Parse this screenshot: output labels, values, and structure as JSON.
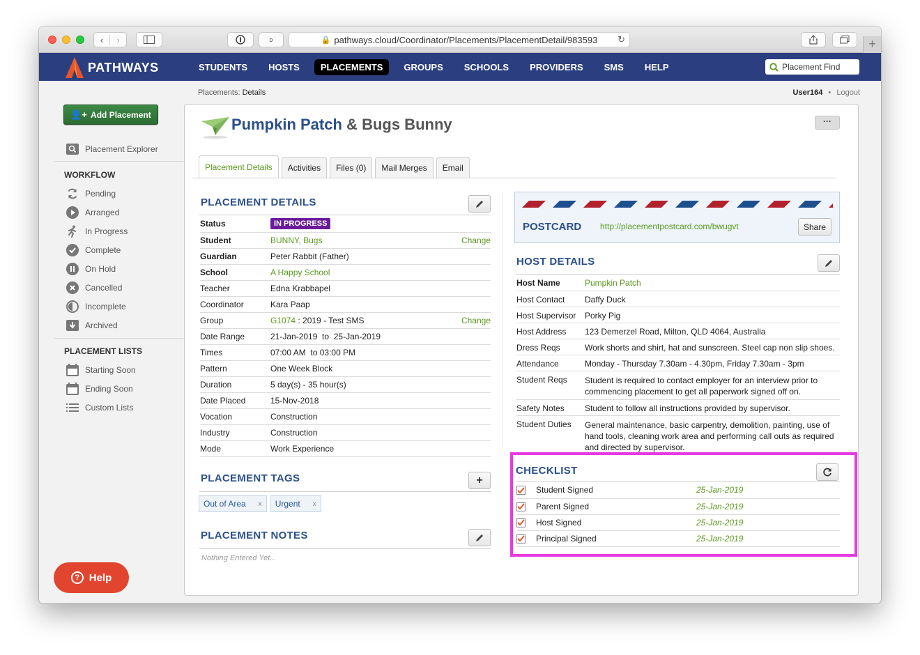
{
  "browser": {
    "url": "pathways.cloud/Coordinator/Placements/PlacementDetail/983593"
  },
  "app": {
    "name": "PATHWAYS",
    "nav": [
      "STUDENTS",
      "HOSTS",
      "PLACEMENTS",
      "GROUPS",
      "SCHOOLS",
      "PROVIDERS",
      "SMS",
      "HELP"
    ],
    "active_nav": "PLACEMENTS",
    "search_placeholder": "Placement Find",
    "colors": {
      "nav_bg": "#2b3f80",
      "accent_green": "#5a9a1e",
      "heading_blue": "#2b4f8c",
      "badge_purple": "#6a1b9a",
      "help_red": "#e2452f",
      "highlight": "#e63be0"
    }
  },
  "sidebar": {
    "add_button": "Add Placement",
    "explorer": "Placement Explorer",
    "workflow_heading": "WORKFLOW",
    "workflow": [
      {
        "label": "Pending",
        "icon": "refresh-icon"
      },
      {
        "label": "Arranged",
        "icon": "play-circle-icon"
      },
      {
        "label": "In Progress",
        "icon": "running-person-icon"
      },
      {
        "label": "Complete",
        "icon": "check-circle-icon"
      },
      {
        "label": "On Hold",
        "icon": "pause-circle-icon"
      },
      {
        "label": "Cancelled",
        "icon": "x-circle-icon"
      },
      {
        "label": "Incomplete",
        "icon": "half-circle-icon"
      },
      {
        "label": "Archived",
        "icon": "archive-icon"
      }
    ],
    "lists_heading": "PLACEMENT LISTS",
    "lists": [
      {
        "label": "Starting Soon",
        "icon": "calendar-icon"
      },
      {
        "label": "Ending Soon",
        "icon": "calendar-icon"
      },
      {
        "label": "Custom Lists",
        "icon": "list-icon"
      }
    ],
    "help_button": "Help"
  },
  "breadcrumb": {
    "parent": "Placements",
    "sep": ":",
    "current": "Details"
  },
  "userbar": {
    "user": "User164",
    "dot": "•",
    "logout": "Logout"
  },
  "header": {
    "host": "Pumpkin Patch",
    "amp": "&",
    "student": "Bugs Bunny",
    "more": "···"
  },
  "tabs": [
    "Placement Details",
    "Activities",
    "Files (0)",
    "Mail Merges",
    "Email"
  ],
  "placement_details": {
    "heading": "PLACEMENT DETAILS",
    "change_label": "Change",
    "status_label": "Status",
    "status_value": "IN PROGRESS",
    "student_label": "Student",
    "student_value": "BUNNY, Bugs",
    "guardian_label": "Guardian",
    "guardian_value": "Peter Rabbit (Father)",
    "school_label": "School",
    "school_value": "A Happy School",
    "teacher_label": "Teacher",
    "teacher_value": "Edna Krabbapel",
    "coordinator_label": "Coordinator",
    "coordinator_value": "Kara Paap",
    "group_label": "Group",
    "group_code": "G1074",
    "group_rest": " : 2019 - Test SMS",
    "date_range_label": "Date Range",
    "date_range_value": "21-Jan-2019  to  25-Jan-2019",
    "times_label": "Times",
    "times_value": "07:00 AM  to 03:00 PM",
    "pattern_label": "Pattern",
    "pattern_value": "One Week Block",
    "duration_label": "Duration",
    "duration_value": "5 day(s) - 35 hour(s)",
    "date_placed_label": "Date Placed",
    "date_placed_value": "15-Nov-2018",
    "vocation_label": "Vocation",
    "vocation_value": "Construction",
    "industry_label": "Industry",
    "industry_value": "Construction",
    "mode_label": "Mode",
    "mode_value": "Work Experience"
  },
  "tags": {
    "heading": "PLACEMENT TAGS",
    "items": [
      {
        "label": "Out of Area",
        "remove": "x"
      },
      {
        "label": "Urgent",
        "remove": "x"
      }
    ]
  },
  "notes": {
    "heading": "PLACEMENT NOTES",
    "empty": "Nothing Entered Yet..."
  },
  "postcard": {
    "label": "POSTCARD",
    "url": "http://placementpostcard.com/bwugvt",
    "share": "Share"
  },
  "host_details": {
    "heading": "HOST DETAILS",
    "rows": [
      {
        "label": "Host Name",
        "value": "Pumpkin Patch"
      },
      {
        "label": "Host Contact",
        "value": "Daffy Duck"
      },
      {
        "label": "Host Supervisor",
        "value": "Porky Pig"
      },
      {
        "label": "Host Address",
        "value": "123 Demerzel Road, Milton, QLD 4064, Australia"
      },
      {
        "label": "Dress Reqs",
        "value": "Work shorts and shirt, hat and sunscreen. Steel cap non slip shoes."
      },
      {
        "label": "Attendance",
        "value": "Monday - Thursday 7.30am - 4.30pm, Friday 7.30am - 3pm"
      },
      {
        "label": "Student Reqs",
        "value": "Student is required to contact employer for an interview prior to commencing placement to get all paperwork signed off on."
      },
      {
        "label": "Safety Notes",
        "value": "Student to follow all instructions provided by supervisor."
      },
      {
        "label": "Student Duties",
        "value": "General maintenance, basic carpentry, demolition, painting, use of hand tools, cleaning work area and performing call outs as required and directed by supervisor."
      }
    ]
  },
  "checklist": {
    "heading": "CHECKLIST",
    "items": [
      {
        "label": "Student Signed",
        "date": "25-Jan-2019",
        "checked": true
      },
      {
        "label": "Parent Signed",
        "date": "25-Jan-2019",
        "checked": true
      },
      {
        "label": "Host Signed",
        "date": "25-Jan-2019",
        "checked": true
      },
      {
        "label": "Principal Signed",
        "date": "25-Jan-2019",
        "checked": true
      }
    ]
  }
}
